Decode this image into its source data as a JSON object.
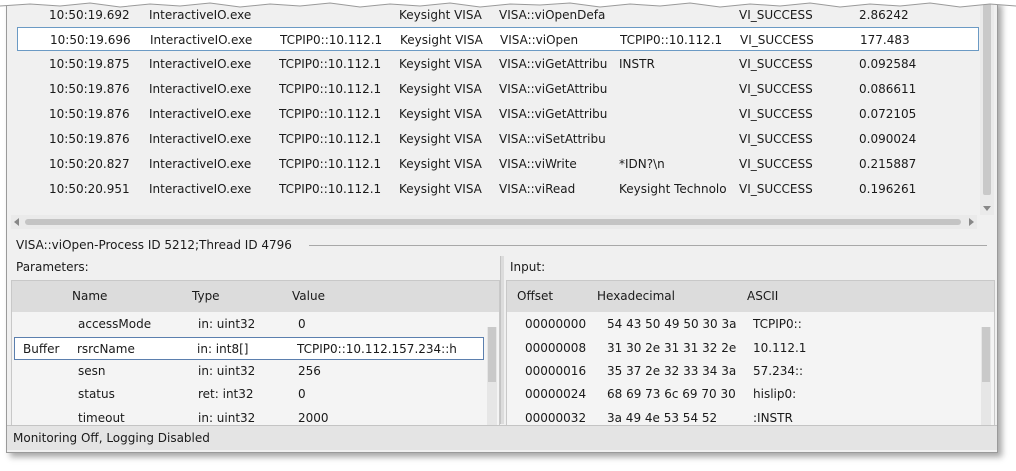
{
  "trace": {
    "rows": [
      {
        "time": "10:50:19.692",
        "process": "InteractiveIO.exe",
        "address": "",
        "library": "Keysight VISA",
        "function": "VISA::viOpenDefa",
        "argument": "",
        "status": "VI_SUCCESS",
        "duration": "2.86242"
      },
      {
        "time": "10:50:19.696",
        "process": "InteractiveIO.exe",
        "address": "TCPIP0::10.112.1",
        "library": "Keysight VISA",
        "function": "VISA::viOpen",
        "argument": "TCPIP0::10.112.1",
        "status": "VI_SUCCESS",
        "duration": "177.483"
      },
      {
        "time": "10:50:19.875",
        "process": "InteractiveIO.exe",
        "address": "TCPIP0::10.112.1",
        "library": "Keysight VISA",
        "function": "VISA::viGetAttribu",
        "argument": "INSTR",
        "status": "VI_SUCCESS",
        "duration": "0.092584"
      },
      {
        "time": "10:50:19.876",
        "process": "InteractiveIO.exe",
        "address": "TCPIP0::10.112.1",
        "library": "Keysight VISA",
        "function": "VISA::viGetAttribu",
        "argument": "",
        "status": "VI_SUCCESS",
        "duration": "0.086611"
      },
      {
        "time": "10:50:19.876",
        "process": "InteractiveIO.exe",
        "address": "TCPIP0::10.112.1",
        "library": "Keysight VISA",
        "function": "VISA::viGetAttribu",
        "argument": "",
        "status": "VI_SUCCESS",
        "duration": "0.072105"
      },
      {
        "time": "10:50:19.876",
        "process": "InteractiveIO.exe",
        "address": "TCPIP0::10.112.1",
        "library": "Keysight VISA",
        "function": "VISA::viSetAttribu",
        "argument": "",
        "status": "VI_SUCCESS",
        "duration": "0.090024"
      },
      {
        "time": "10:50:20.827",
        "process": "InteractiveIO.exe",
        "address": "TCPIP0::10.112.1",
        "library": "Keysight VISA",
        "function": "VISA::viWrite",
        "argument": "*IDN?\\n",
        "status": "VI_SUCCESS",
        "duration": "0.215887"
      },
      {
        "time": "10:50:20.951",
        "process": "InteractiveIO.exe",
        "address": "TCPIP0::10.112.1",
        "library": "Keysight VISA",
        "function": "VISA::viRead",
        "argument": "Keysight Technolo",
        "status": "VI_SUCCESS",
        "duration": "0.196261"
      }
    ]
  },
  "details": {
    "call_title": "VISA::viOpen-Process ID 5212;Thread ID 4796",
    "parameters_label": "Parameters:",
    "input_label": "Input:"
  },
  "parameters": {
    "headers": {
      "name": "Name",
      "type": "Type",
      "value": "Value"
    },
    "rows": [
      {
        "tag": "",
        "name": "accessMode",
        "type": "in: uint32",
        "value": "0"
      },
      {
        "tag": "Buffer",
        "name": "rsrcName",
        "type": "in: int8[]",
        "value": "TCPIP0::10.112.157.234::h"
      },
      {
        "tag": "",
        "name": "sesn",
        "type": "in: uint32",
        "value": "256"
      },
      {
        "tag": "",
        "name": "status",
        "type": "ret: int32",
        "value": "0"
      },
      {
        "tag": "",
        "name": "timeout",
        "type": "in: uint32",
        "value": "2000"
      }
    ]
  },
  "input": {
    "headers": {
      "offset": "Offset",
      "hex": "Hexadecimal",
      "ascii": "ASCII"
    },
    "rows": [
      {
        "offset": "00000000",
        "hex": "54 43 50 49 50 30 3a",
        "ascii": "TCPIP0::"
      },
      {
        "offset": "00000008",
        "hex": "31 30 2e 31 31 32 2e",
        "ascii": "10.112.1"
      },
      {
        "offset": "00000016",
        "hex": "35 37 2e 32 33 34 3a",
        "ascii": "57.234::"
      },
      {
        "offset": "00000024",
        "hex": "68 69 73 6c 69 70 30",
        "ascii": "hislip0:"
      },
      {
        "offset": "00000032",
        "hex": "3a 49 4e 53 54 52",
        "ascii": ":INSTR"
      }
    ]
  },
  "status_bar": {
    "text": "Monitoring Off, Logging Disabled"
  },
  "colors": {
    "selection_border": "#6b9ac4",
    "panel_header": "#dcdcdc",
    "background": "#f0f0f0"
  }
}
